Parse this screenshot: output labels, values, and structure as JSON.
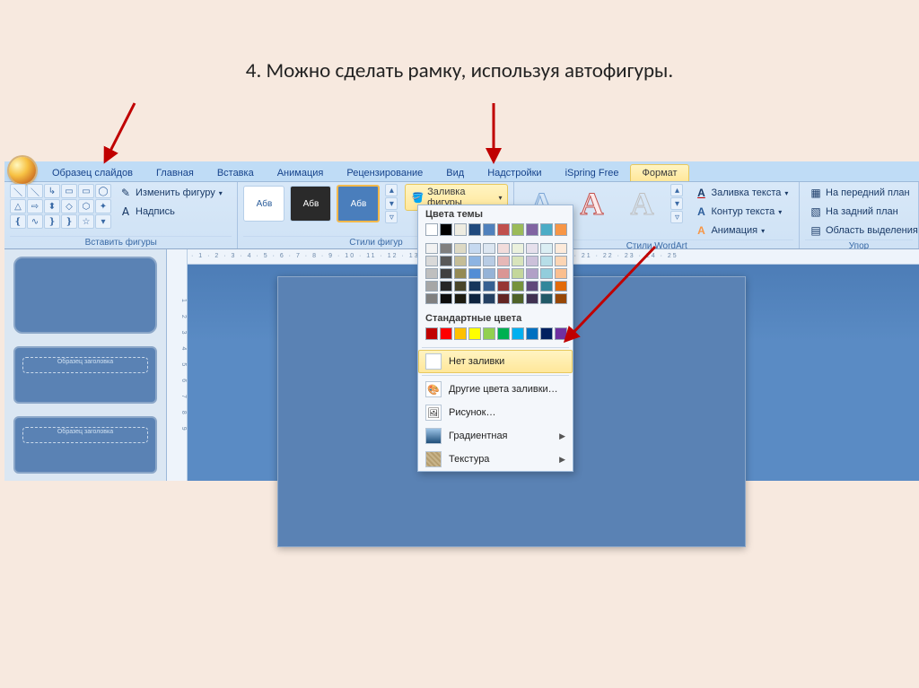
{
  "title": "4. Можно сделать рамку, используя автофигуры.",
  "tabs": {
    "items": [
      "Образец слайдов",
      "Главная",
      "Вставка",
      "Анимация",
      "Рецензирование",
      "Вид",
      "Надстройки",
      "iSpring Free",
      "Формат"
    ],
    "active_index": 8
  },
  "groups": {
    "insert_shapes": {
      "label": "Вставить фигуры",
      "edit_shape": "Изменить фигуру",
      "text_box": "Надпись"
    },
    "shape_styles": {
      "label": "Стили фигур",
      "thumb_text": "Абв",
      "fill_button": "Заливка фигуры"
    },
    "wordart": {
      "label": "Стили WordArt",
      "glyph": "А",
      "text_fill": "Заливка текста",
      "text_outline": "Контур текста",
      "animation": "Анимация"
    },
    "arrange": {
      "label": "Упор",
      "bring_front": "На передний план",
      "send_back": "На задний план",
      "selection_pane": "Область выделения"
    }
  },
  "fill_popup": {
    "theme_header": "Цвета темы",
    "standard_header": "Стандартные цвета",
    "no_fill": "Нет заливки",
    "more_colors": "Другие цвета заливки…",
    "picture": "Рисунок…",
    "gradient": "Градиентная",
    "texture": "Текстура",
    "theme_row": [
      "#ffffff",
      "#000000",
      "#eeece1",
      "#1f497d",
      "#4f81bd",
      "#c0504d",
      "#9bbb59",
      "#8064a2",
      "#4bacc6",
      "#f79646"
    ],
    "theme_tints": [
      [
        "#f2f2f2",
        "#7f7f7f",
        "#ddd9c4",
        "#c6d9f0",
        "#dce6f1",
        "#f2dcdb",
        "#ebf1dd",
        "#e6e0ec",
        "#dbeef3",
        "#fdeada"
      ],
      [
        "#d9d9d9",
        "#595959",
        "#c4bd97",
        "#8db4e2",
        "#b8cce4",
        "#e6b8b7",
        "#d8e4bc",
        "#ccc1da",
        "#b7dee8",
        "#fcd5b4"
      ],
      [
        "#bfbfbf",
        "#404040",
        "#948a54",
        "#538dd5",
        "#95b3d7",
        "#da9694",
        "#c4d79b",
        "#b1a0c7",
        "#92cddc",
        "#fabf8f"
      ],
      [
        "#a6a6a6",
        "#262626",
        "#494529",
        "#16365c",
        "#366092",
        "#963634",
        "#76933c",
        "#60497a",
        "#31869b",
        "#e26b0a"
      ],
      [
        "#808080",
        "#0d0d0d",
        "#1d1b10",
        "#0f243e",
        "#244062",
        "#632523",
        "#4f6228",
        "#403151",
        "#215967",
        "#974706"
      ]
    ],
    "standard_row": [
      "#c00000",
      "#ff0000",
      "#ffc000",
      "#ffff00",
      "#92d050",
      "#00b050",
      "#00b0f0",
      "#0070c0",
      "#002060",
      "#7030a0"
    ]
  },
  "thumbs": {
    "placeholder": "Образец заголовка"
  },
  "ruler": {
    "h": "· 1 · 2 · 3 · 4 · 5 · 6 · 7 · 8 · 9 · 10 · 11 · 12 · 13 · 14 · 15 · 16 · 17 · 18 · 19 · 20 · 21 · 22 · 23 · 24 · 25",
    "v": "1 2 3 4 5 6 7 8 9"
  }
}
